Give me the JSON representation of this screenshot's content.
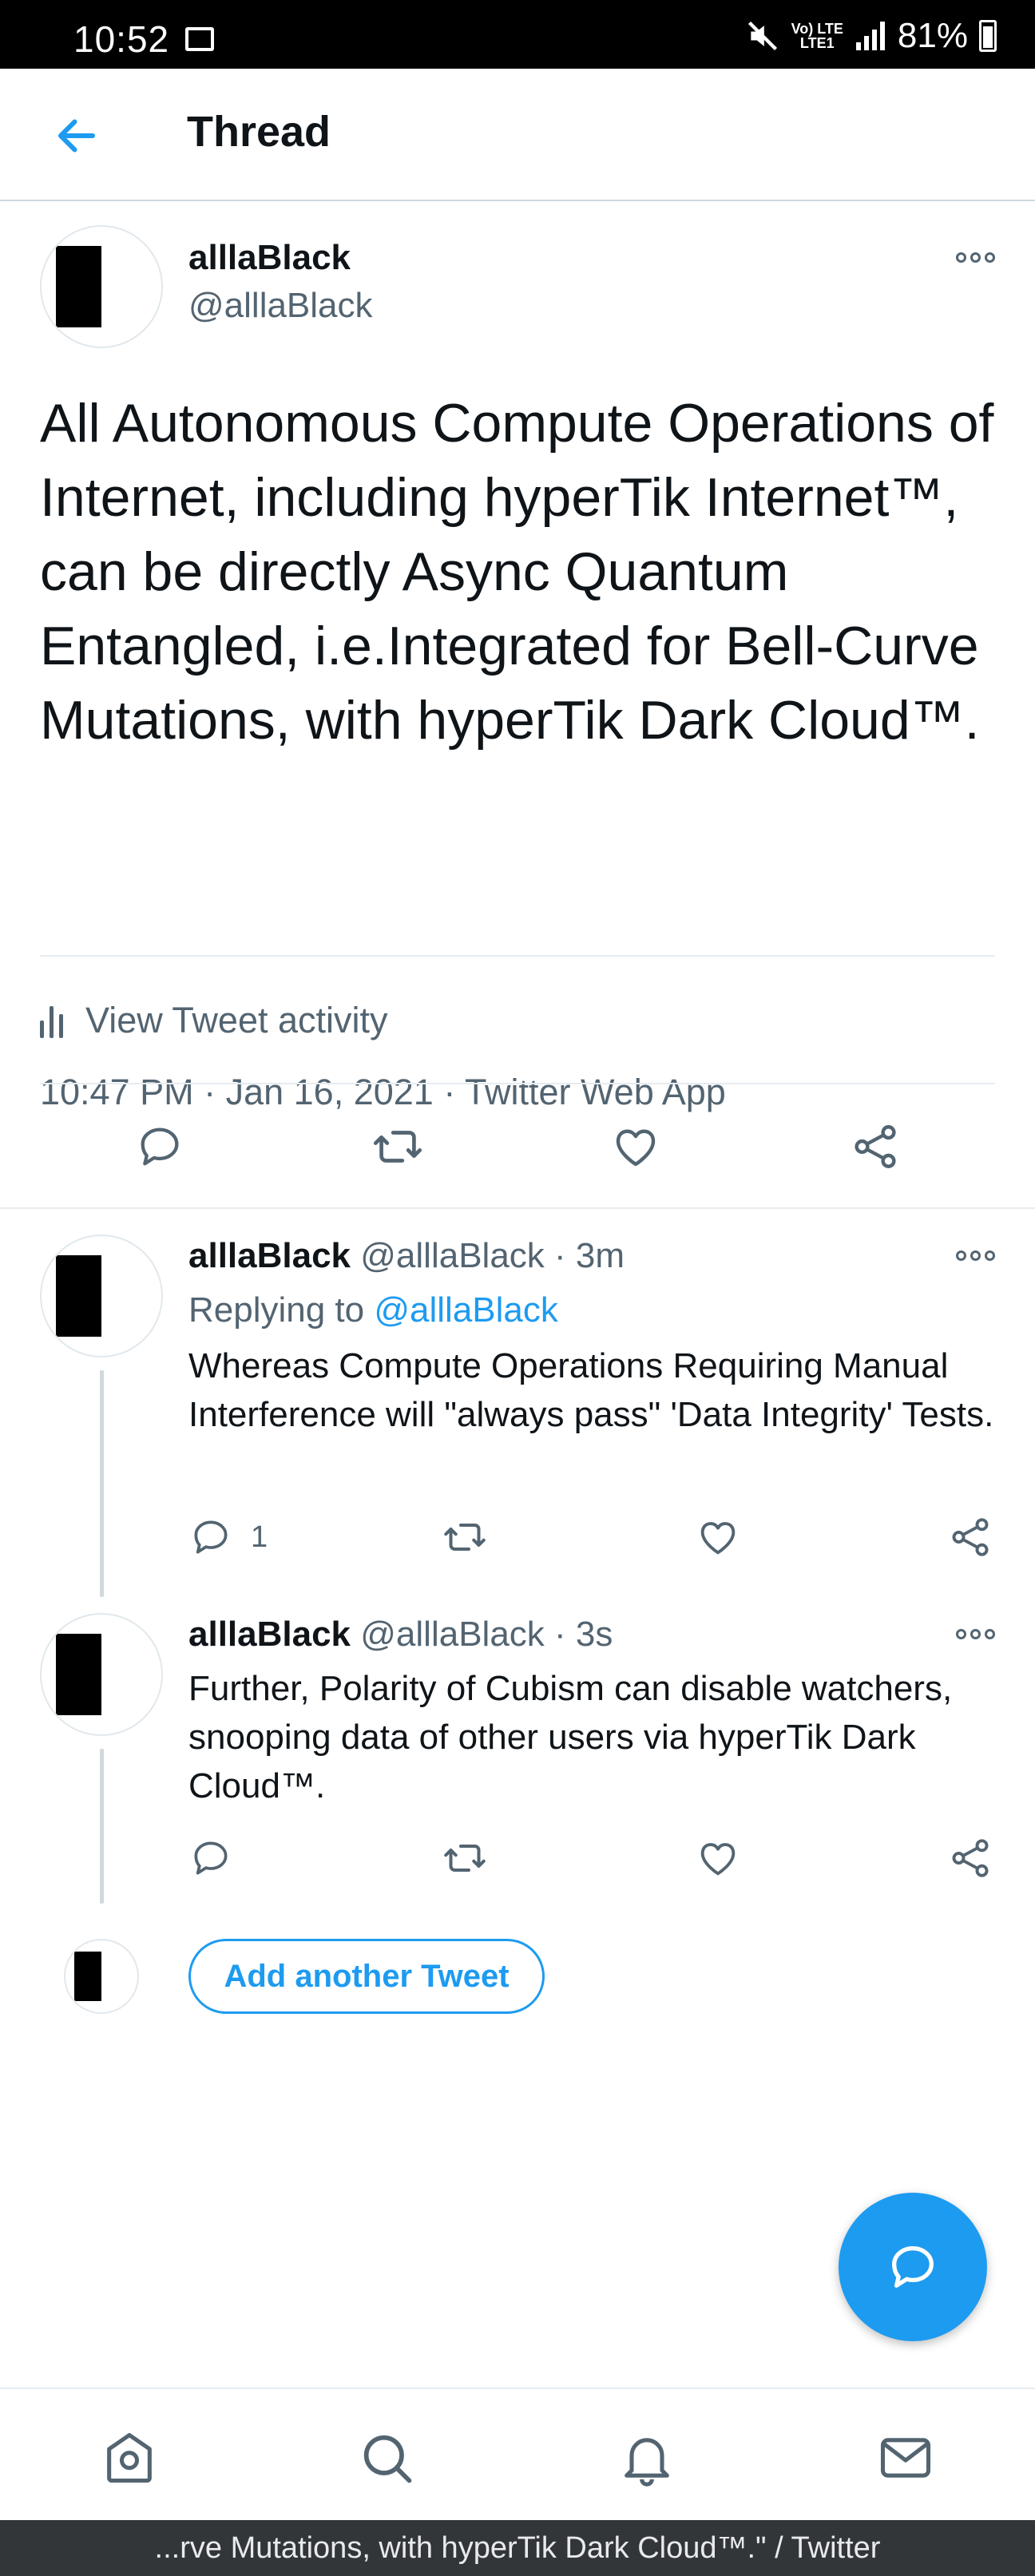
{
  "status_bar": {
    "time": "10:52",
    "net_top": "Vo) LTE",
    "net_bottom": "LTE1",
    "battery": "81%"
  },
  "header": {
    "title": "Thread"
  },
  "main_tweet": {
    "name": "alllaBlack",
    "handle": "@alllaBlack",
    "text": "All Autonomous Compute Operations of Internet, including hyperTik Internet™, can be directly Async Quantum Entangled, i.e.Integrated for Bell-Curve Mutations, with hyperTik Dark Cloud™.",
    "timestamp": "10:47 PM · Jan 16, 2021 · Twitter Web App",
    "activity_label": "View Tweet activity"
  },
  "replies": [
    {
      "name": "alllaBlack",
      "handle_time": "@alllaBlack · 3m",
      "replying_prefix": "Replying to ",
      "replying_to": "@alllaBlack",
      "text": "Whereas Compute Operations Requiring Manual Interference will \"always pass\" 'Data Integrity' Tests.",
      "reply_count": "1"
    },
    {
      "name": "alllaBlack",
      "handle_time": "@alllaBlack · 3s",
      "text": "Further, Polarity of Cubism can disable watchers, snooping data of other users via hyperTik Dark Cloud™.",
      "reply_count": ""
    }
  ],
  "add_tweet_label": "Add another Tweet",
  "browser_title": "...rve Mutations, with hyperTik Dark Cloud™.\" / Twitter",
  "colors": {
    "accent": "#1d9bf0",
    "secondary_text": "#536471",
    "divider": "#e6ecf0"
  },
  "icons": {
    "back": "arrow-left-icon",
    "more": "more-dots-icon",
    "reply": "reply-icon",
    "retweet": "retweet-icon",
    "like": "heart-icon",
    "share": "share-icon",
    "compose": "compose-icon",
    "home": "home-icon",
    "search": "search-icon",
    "notifications": "bell-icon",
    "messages": "mail-icon"
  }
}
